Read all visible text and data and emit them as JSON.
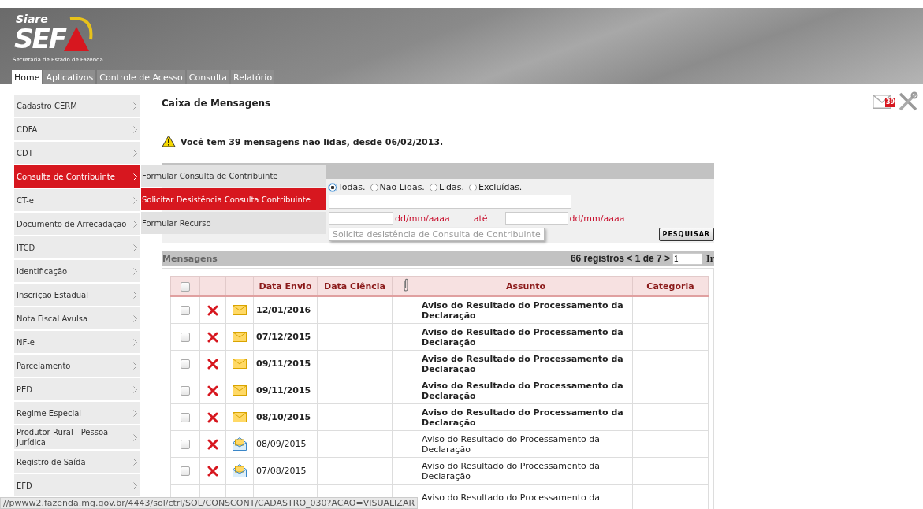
{
  "header": {
    "logo": {
      "top": "Siare",
      "main": "SEF",
      "subtitle": "Secretaria de Estado de Fazenda"
    },
    "tabs": [
      {
        "label": "Home",
        "selected": true
      },
      {
        "label": "Aplicativos",
        "selected": false
      },
      {
        "label": "Controle de Acesso",
        "selected": false
      },
      {
        "label": "Consulta",
        "selected": false
      },
      {
        "label": "Relatório",
        "selected": false
      }
    ]
  },
  "notifications": {
    "count": "39"
  },
  "sidebar": {
    "items": [
      {
        "label": "Cadastro CERM",
        "selected": false
      },
      {
        "label": "CDFA",
        "selected": false
      },
      {
        "label": "CDT",
        "selected": false
      },
      {
        "label": "Consulta de Contribuinte",
        "selected": true
      },
      {
        "label": "CT-e",
        "selected": false
      },
      {
        "label": "Documento de Arrecadação",
        "selected": false
      },
      {
        "label": "ITCD",
        "selected": false
      },
      {
        "label": "Identificação",
        "selected": false
      },
      {
        "label": "Inscrição Estadual",
        "selected": false
      },
      {
        "label": "Nota Fiscal Avulsa",
        "selected": false
      },
      {
        "label": "NF-e",
        "selected": false
      },
      {
        "label": "Parcelamento",
        "selected": false
      },
      {
        "label": "PED",
        "selected": false
      },
      {
        "label": "Regime Especial",
        "selected": false
      },
      {
        "label": "Produtor Rural - Pessoa Jurídica",
        "selected": false
      },
      {
        "label": "Registro de Saída",
        "selected": false
      },
      {
        "label": "EFD",
        "selected": false
      }
    ],
    "submenu": [
      {
        "label": "Formular Consulta de Contribuinte",
        "selected": false
      },
      {
        "label": "Solicitar Desistência Consulta Contribuinte",
        "selected": true
      },
      {
        "label": "Formular Recurso",
        "selected": false
      }
    ]
  },
  "tooltip": "Solicita desistência de Consulta de Contribuinte",
  "content": {
    "title": "Caixa de Mensagens",
    "alert": "Você tem 39 mensagens não lidas, desde 06/02/2013.",
    "filter": {
      "radios": [
        {
          "label": "Todas.",
          "selected": true
        },
        {
          "label": "Não Lidas.",
          "selected": false
        },
        {
          "label": "Lidas.",
          "selected": false
        },
        {
          "label": "Excluídas.",
          "selected": false
        }
      ],
      "date_from_hint": "dd/mm/aaaa",
      "date_separator": "até",
      "date_to_hint": "dd/mm/aaaa",
      "search_button": "PESQUISAR"
    },
    "messages": {
      "title": "Mensagens",
      "pager": "66 registros < 1 de 7 >",
      "page_input": "1",
      "go": "Ir"
    },
    "table": {
      "columns": [
        "Data Envio",
        "Data Ciência",
        "Assunto",
        "Categoria"
      ],
      "rows": [
        {
          "checked": false,
          "unread": true,
          "date": "12/01/2016",
          "subject": "Aviso do Resultado do Processamento da Declaração"
        },
        {
          "checked": false,
          "unread": true,
          "date": "07/12/2015",
          "subject": "Aviso do Resultado do Processamento da Declaração"
        },
        {
          "checked": false,
          "unread": true,
          "date": "09/11/2015",
          "subject": "Aviso do Resultado do Processamento da Declaração"
        },
        {
          "checked": false,
          "unread": true,
          "date": "09/11/2015",
          "subject": "Aviso do Resultado do Processamento da Declaração"
        },
        {
          "checked": false,
          "unread": true,
          "date": "08/10/2015",
          "subject": "Aviso do Resultado do Processamento da Declaração"
        },
        {
          "checked": false,
          "unread": false,
          "date": "08/09/2015",
          "subject": "Aviso do Resultado do Processamento da Declaração"
        },
        {
          "checked": false,
          "unread": false,
          "date": "07/08/2015",
          "subject": "Aviso do Resultado do Processamento da Declaração"
        },
        {
          "unread": false,
          "subject": "Aviso do Resultado do Processamento da"
        }
      ],
      "all_checked": false
    }
  },
  "status_bar": "//pwww2.fazenda.mg.gov.br/4443/sol/ctrl/SOL/CONSCONT/CADASTRO_030?ACAO=VISUALIZAR"
}
